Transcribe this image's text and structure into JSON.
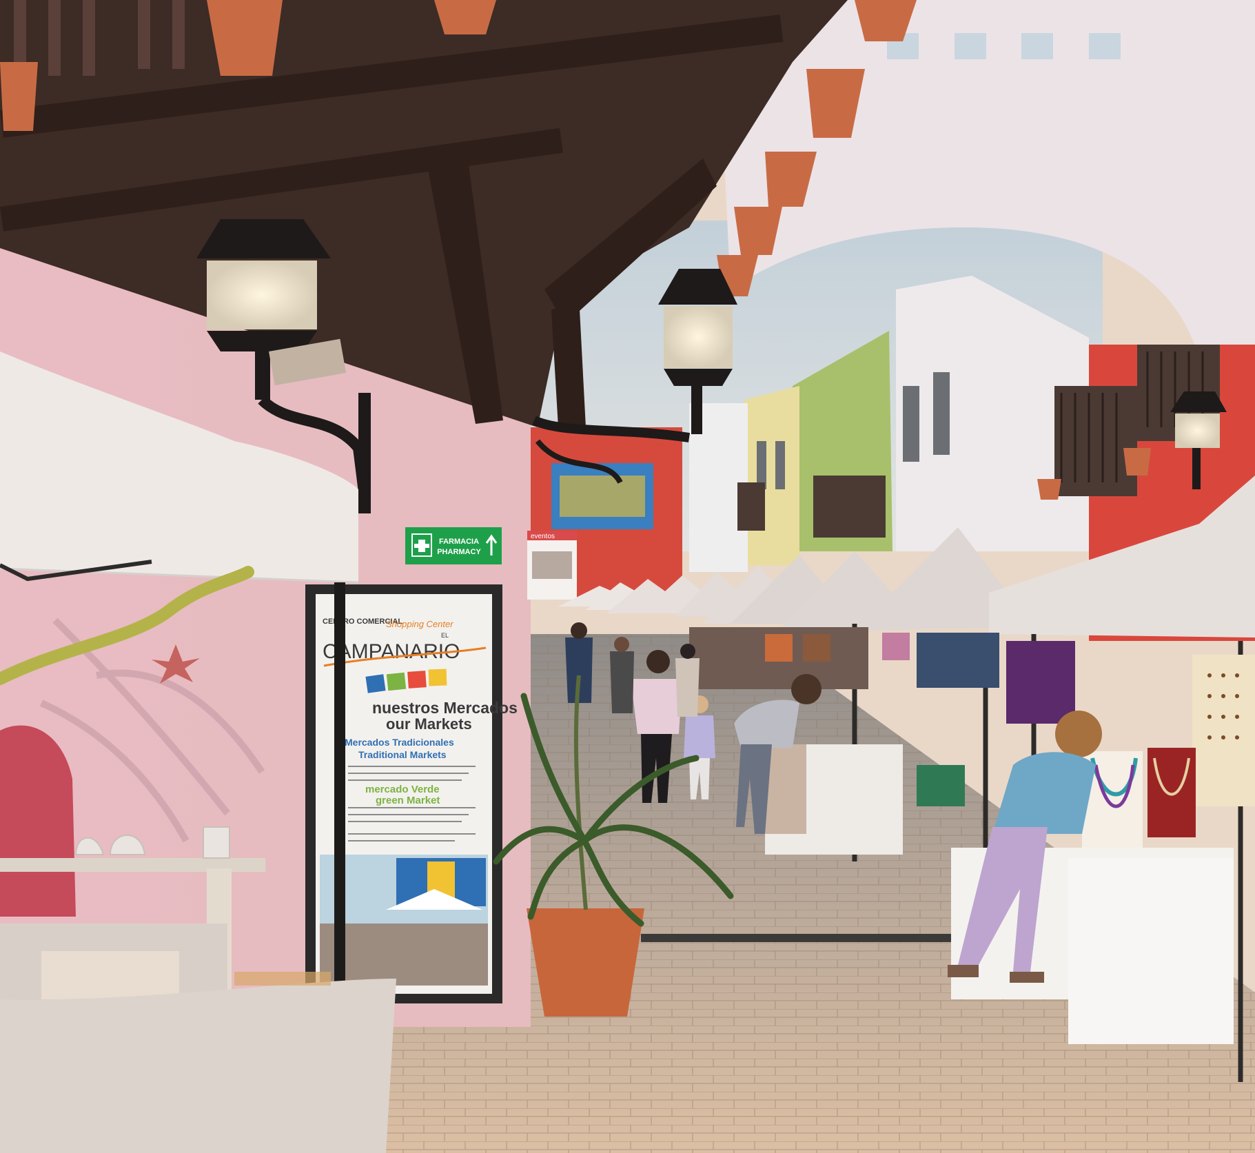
{
  "scene": {
    "description_kind": "photo",
    "pharmacy_sign": {
      "line1": "FARMACIA",
      "line2": "PHARMACY",
      "color": "#1ea04a"
    },
    "poster": {
      "header_small": "CENTRO COMERCIAL",
      "header_script": "Shopping Center",
      "header_el": "EL",
      "brand": "CAMPANARIO",
      "line_es_1": "nuestros Mercados",
      "line_en_1": "our Markets",
      "line_es_2": "Mercados Tradicionales",
      "line_en_2": "Traditional Markets",
      "line_es_3": "mercado Verde",
      "line_en_3": "green Market",
      "accent_color": "#7cb342",
      "text_color": "#3a3a3a"
    },
    "events_sign": {
      "label": "eventos"
    },
    "colors": {
      "pink_wall": "#e8bfc3",
      "white_arch": "#ece3e6",
      "wood_beams": "#3b2a24",
      "red_building": "#d84a3e",
      "yellow_building": "#e7dc9c",
      "green_building": "#a9c26a",
      "awning_white": "#ece6e2",
      "sky": "#c9d3da",
      "pavement": "#c9b8a8"
    }
  }
}
